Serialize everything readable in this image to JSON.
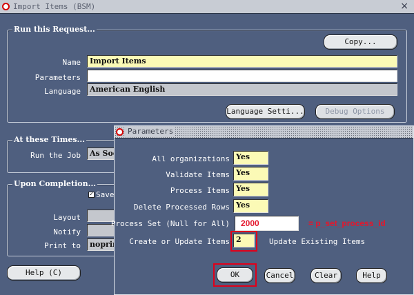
{
  "window": {
    "title": "Import Items (BSM)",
    "close_glyph": "×"
  },
  "run_request": {
    "group_title": "Run this Request...",
    "copy_button": "Copy...",
    "name_label": "Name",
    "name_value": "Import Items",
    "parameters_label": "Parameters",
    "parameters_value": "",
    "language_label": "Language",
    "language_value": "American English",
    "language_settings_button": "Language Setti...",
    "debug_options_button": "Debug Options"
  },
  "times": {
    "group_title": "At these Times...",
    "run_job_label": "Run the Job",
    "run_job_value": "As Soo"
  },
  "completion": {
    "group_title": "Upon Completion...",
    "save_label": "Save",
    "save_checked": "✓",
    "layout_label": "Layout",
    "notify_label": "Notify",
    "print_to_label": "Print to",
    "print_to_value": "noprint"
  },
  "help_button": "Help (C)",
  "dialog": {
    "title": "Parameters",
    "rows": [
      {
        "label": "All organizations",
        "value": "Yes"
      },
      {
        "label": "Validate Items",
        "value": "Yes"
      },
      {
        "label": "Process Items",
        "value": "Yes"
      },
      {
        "label": "Delete Processed Rows",
        "value": "Yes"
      }
    ],
    "process_set_label": "Process Set (Null for All)",
    "process_set_value": "2000",
    "process_set_annotation": "= p_set_process_id",
    "create_update_label": "Create or Update Items",
    "create_update_value": "2",
    "create_update_desc": "Update Existing Items",
    "buttons": {
      "ok": "OK",
      "cancel": "Cancel",
      "clear": "Clear",
      "help": "Help"
    }
  },
  "colors": {
    "background": "#4f5f7f",
    "field_yellow": "#fbfab6",
    "highlight_red": "#e0001a"
  },
  "icons": {
    "window_icon": "oracle-logo-icon",
    "dialog_icon": "oracle-logo-icon",
    "close": "close-icon"
  }
}
